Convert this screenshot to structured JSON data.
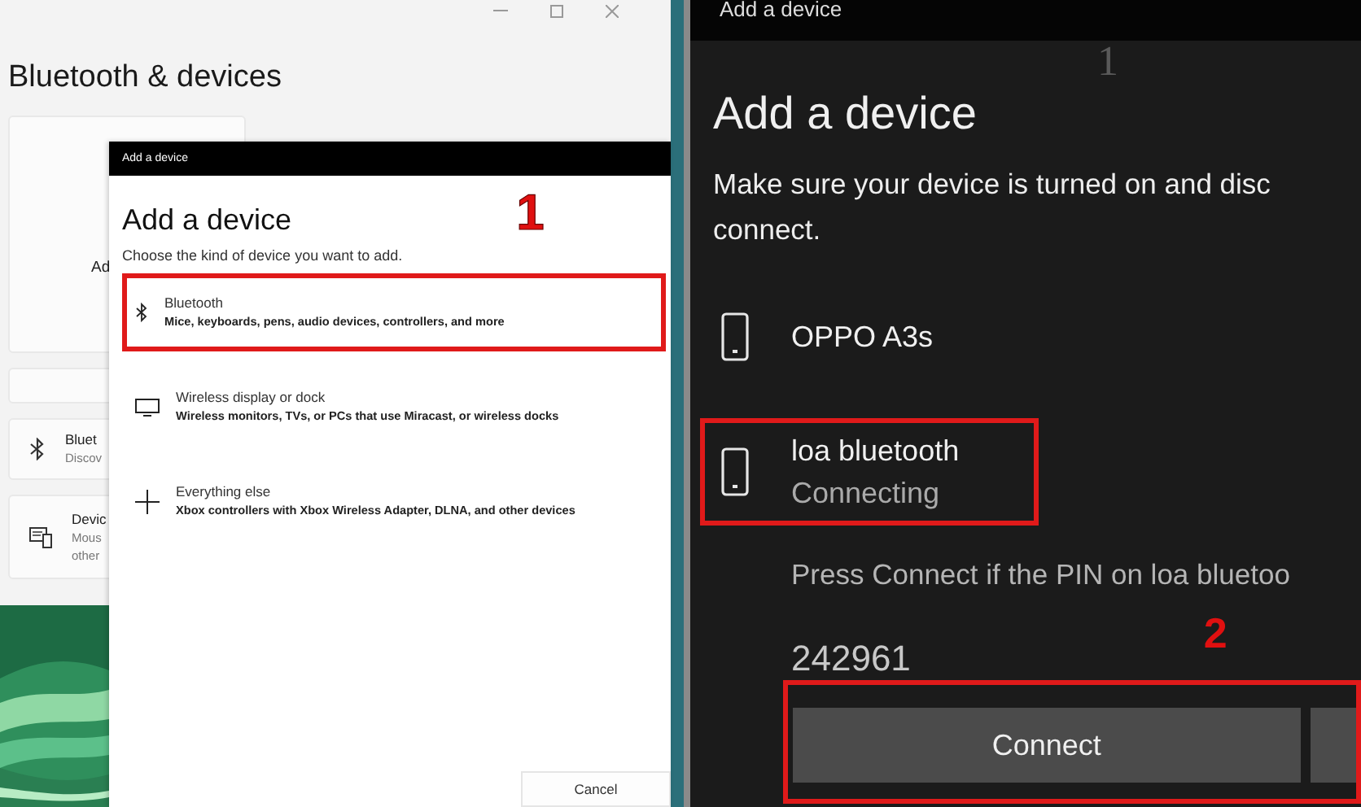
{
  "settings_window": {
    "title": "Bluetooth & devices",
    "cards": [
      {
        "kind": "tile",
        "title": "Ad"
      },
      {
        "kind": "blank"
      },
      {
        "kind": "row",
        "title": "Bluet",
        "subtitle": "Discov"
      },
      {
        "kind": "row",
        "title": "Devic",
        "subtitle": "Mous",
        "subtitle_2": "other"
      }
    ]
  },
  "add_device_dialog": {
    "titlebar": "Add a device",
    "heading": "Add a device",
    "instruction": "Choose the kind of device you want to add.",
    "annotation": "1",
    "options": [
      {
        "title": "Bluetooth",
        "description": "Mice, keyboards, pens, audio devices, controllers, and more",
        "highlighted": true
      },
      {
        "title": "Wireless display or dock",
        "description": "Wireless monitors, TVs, or PCs that use Miracast, or wireless docks",
        "highlighted": false
      },
      {
        "title": "Everything else",
        "description": "Xbox controllers with Xbox Wireless Adapter, DLNA, and other devices",
        "highlighted": false
      }
    ],
    "cancel": "Cancel"
  },
  "pairing_dialog": {
    "titlebar": "Add a device",
    "faint_mark": "1",
    "heading": "Add a device",
    "instruction_lines": [
      "Make sure your device is turned on and disc",
      "connect."
    ],
    "devices": [
      {
        "name": "OPPO A3s",
        "highlighted": false
      },
      {
        "name": "loa bluetooth",
        "status": "Connecting",
        "highlighted": true
      }
    ],
    "pin_prompt": "Press Connect if the PIN on loa bluetoo",
    "pin": "242961",
    "annotation": "2",
    "connect_button": "Connect",
    "connect_highlighted": true
  }
}
